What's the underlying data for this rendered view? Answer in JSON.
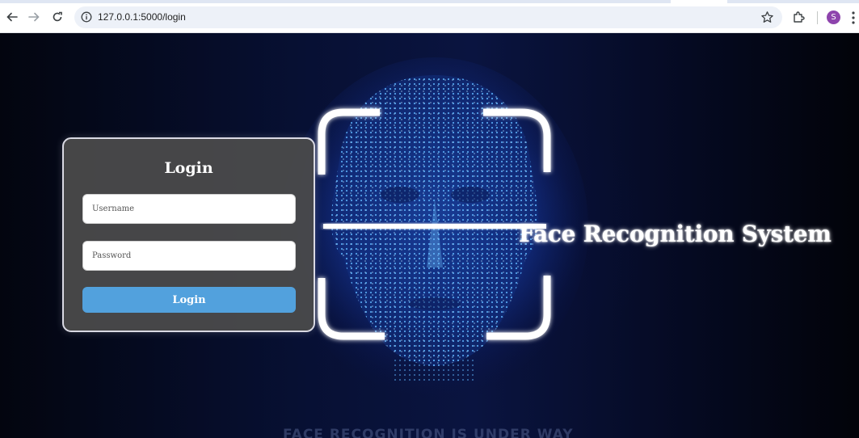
{
  "browser": {
    "url": "127.0.0.1:5000/login",
    "profile_initial": "S",
    "profile_color": "#8e44ad"
  },
  "login": {
    "title": "Login",
    "username_placeholder": "Username",
    "password_placeholder": "Password",
    "button_label": "Login",
    "button_color": "#52a1dd"
  },
  "hero": {
    "title": "Face Recognition System",
    "banner": "FACE RECOGNITION IS UNDER WAY"
  },
  "icons": {
    "back": "arrow-left-icon",
    "forward": "arrow-right-icon",
    "reload": "reload-icon",
    "site_info": "info-icon",
    "bookmark": "star-icon",
    "extensions": "puzzle-icon",
    "menu": "kebab-menu-icon"
  }
}
